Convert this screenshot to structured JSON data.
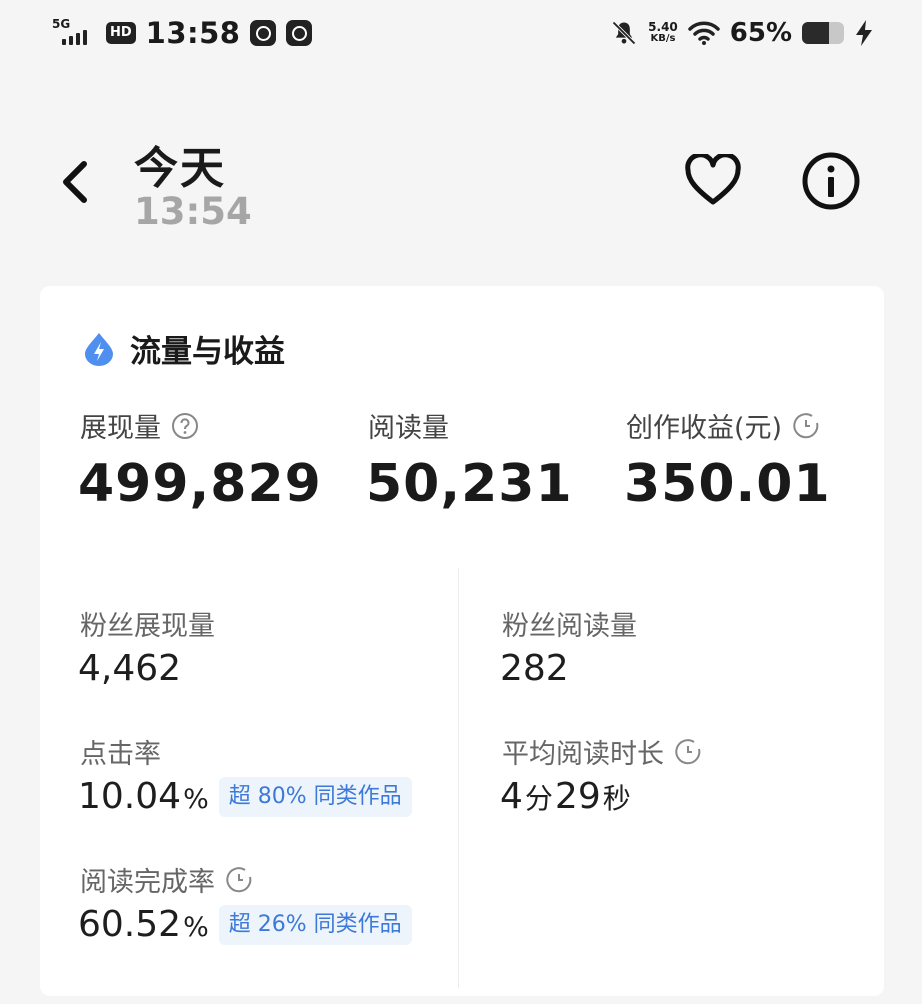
{
  "status_bar": {
    "network": "5G",
    "hd": "HD",
    "time": "13:58",
    "speed": "5.40",
    "speed_unit": "KB/s",
    "battery_pct": "65%",
    "battery_level": 0.65,
    "app_icons": [
      "app-notification-icon",
      "app-notification-icon"
    ]
  },
  "header": {
    "title": "今天",
    "subtitle": "13:54",
    "back_icon": "chevron-left-icon",
    "favorite_icon": "heart-icon",
    "info_icon": "info-icon"
  },
  "section": {
    "title": "流量与收益",
    "icon": "lightning-drop-icon",
    "accent_color": "#4f8ff0"
  },
  "main_metrics": [
    {
      "label": "展现量",
      "value": "499,829",
      "icon": "question-icon"
    },
    {
      "label": "阅读量",
      "value": "50,231"
    },
    {
      "label": "创作收益(元)",
      "value": "350.01",
      "icon": "clock-icon"
    }
  ],
  "left_metrics": {
    "fan_impressions": {
      "label": "粉丝展现量",
      "value": "4,462"
    },
    "ctr": {
      "label": "点击率",
      "value": "10.04",
      "unit": "%",
      "badge": "超 80% 同类作品"
    },
    "completion": {
      "label": "阅读完成率",
      "value": "60.52",
      "unit": "%",
      "badge": "超 26% 同类作品",
      "icon": "clock-icon"
    }
  },
  "right_metrics": {
    "fan_reads": {
      "label": "粉丝阅读量",
      "value": "282"
    },
    "avg_time": {
      "label": "平均阅读时长",
      "value_min": "4",
      "unit_min": "分",
      "value_sec": "29",
      "unit_sec": "秒",
      "icon": "clock-icon"
    }
  },
  "colors": {
    "badge_text": "#3c79d8",
    "badge_bg": "#eef4fc",
    "background": "#f5f5f5"
  }
}
